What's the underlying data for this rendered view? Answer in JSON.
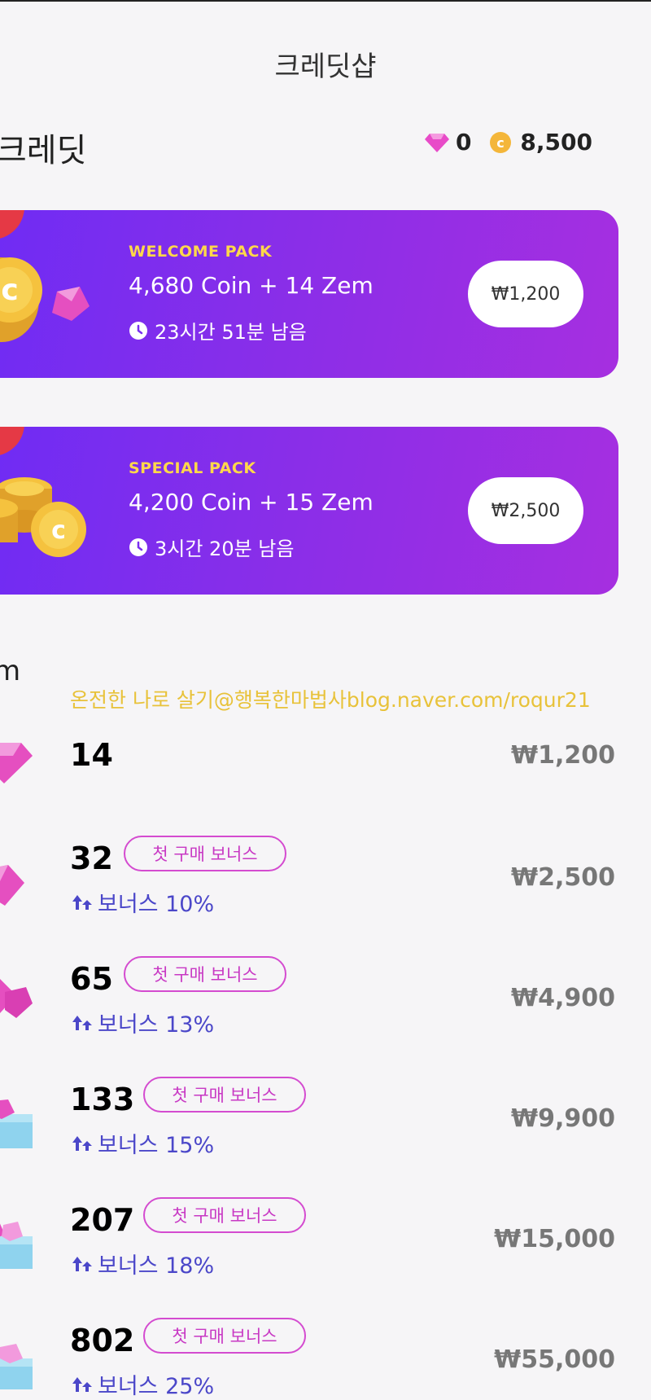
{
  "header": {
    "title": "크레딧샵"
  },
  "credits": {
    "section_title": "크레딧",
    "gem_count": "0",
    "coin_count": "8,500"
  },
  "packs": [
    {
      "label": "WELCOME PACK",
      "desc": "4,680 Coin + 14 Zem",
      "timer": "23시간 51분 남음",
      "price": "₩1,200"
    },
    {
      "label": "SPECIAL PACK",
      "desc": "4,200 Coin + 15 Zem",
      "timer": "3시간 20분 남음",
      "price": "₩2,500"
    }
  ],
  "zem": {
    "section_title": "m",
    "watermark": "온전한 나로 살기@행복한마법사blog.naver.com/roqur21",
    "items": [
      {
        "amount": "14",
        "price": "₩1,200"
      },
      {
        "amount": "32",
        "tag": "첫 구매 보너스",
        "bonus": "보너스 10%",
        "price": "₩2,500"
      },
      {
        "amount": "65",
        "tag": "첫 구매 보너스",
        "bonus": "보너스 13%",
        "price": "₩4,900"
      },
      {
        "amount": "133",
        "tag": "첫 구매 보너스",
        "bonus": "보너스 15%",
        "price": "₩9,900"
      },
      {
        "amount": "207",
        "tag": "첫 구매 보너스",
        "bonus": "보너스 18%",
        "price": "₩15,000"
      },
      {
        "amount": "802",
        "tag": "첫 구매 보너스",
        "bonus": "보너스 25%",
        "price": "₩55,000"
      }
    ]
  },
  "colors": {
    "pack_bg": "#7a2ef0",
    "label": "#ffd84a",
    "tag": "#c839c4",
    "bonus": "#4b47c9",
    "price": "#777777"
  }
}
